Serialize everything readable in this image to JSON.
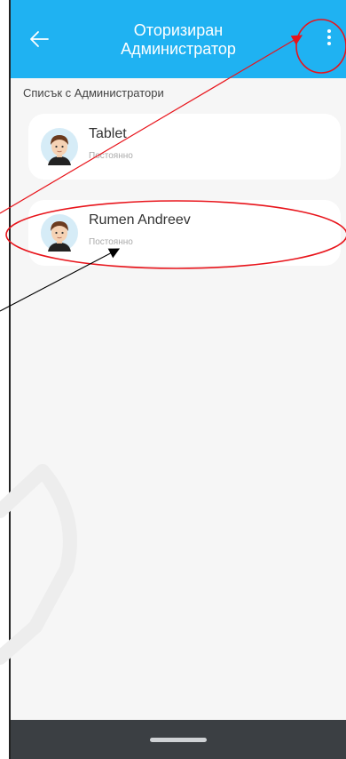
{
  "header": {
    "title_line1": "Оторизиран",
    "title_line2": "Администратор",
    "color": "#1fb2f2",
    "back_icon": "arrow-left-icon",
    "menu_icon": "more-vertical-icon"
  },
  "list": {
    "label": "Списък с Администратори",
    "items": [
      {
        "name": "Tablet",
        "subtitle": "Постоянно"
      },
      {
        "name": "Rumen Andreev",
        "subtitle": "Постоянно"
      }
    ]
  },
  "annotation_color": "#e8141b"
}
